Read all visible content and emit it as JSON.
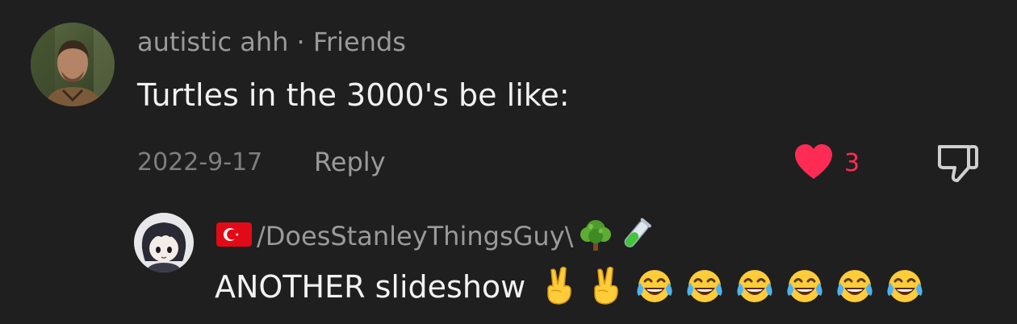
{
  "comment": {
    "author": "autistic ahh",
    "separator": "·",
    "relation": "Friends",
    "text": "Turtles in the 3000's be like:",
    "date": "2022-9-17",
    "reply_label": "Reply",
    "like_count": "3",
    "liked": true,
    "icons": {
      "like": "heart-icon",
      "dislike": "thumbs-down-icon"
    }
  },
  "reply": {
    "author_prefix_flag": "turkey-flag",
    "author": "/DoesStanleyThingsGuy\\",
    "author_suffix_emojis": [
      "tree-emoji",
      "test-tube-emoji"
    ],
    "text": "ANOTHER slideshow",
    "trailing_emojis": [
      "victory-hand",
      "victory-hand",
      "tears-of-joy",
      "tears-of-joy",
      "tears-of-joy",
      "tears-of-joy",
      "tears-of-joy",
      "tears-of-joy"
    ]
  },
  "colors": {
    "background": "#1f1f1f",
    "like_red": "#fe2c55",
    "secondary_text": "#9a9a9a"
  }
}
